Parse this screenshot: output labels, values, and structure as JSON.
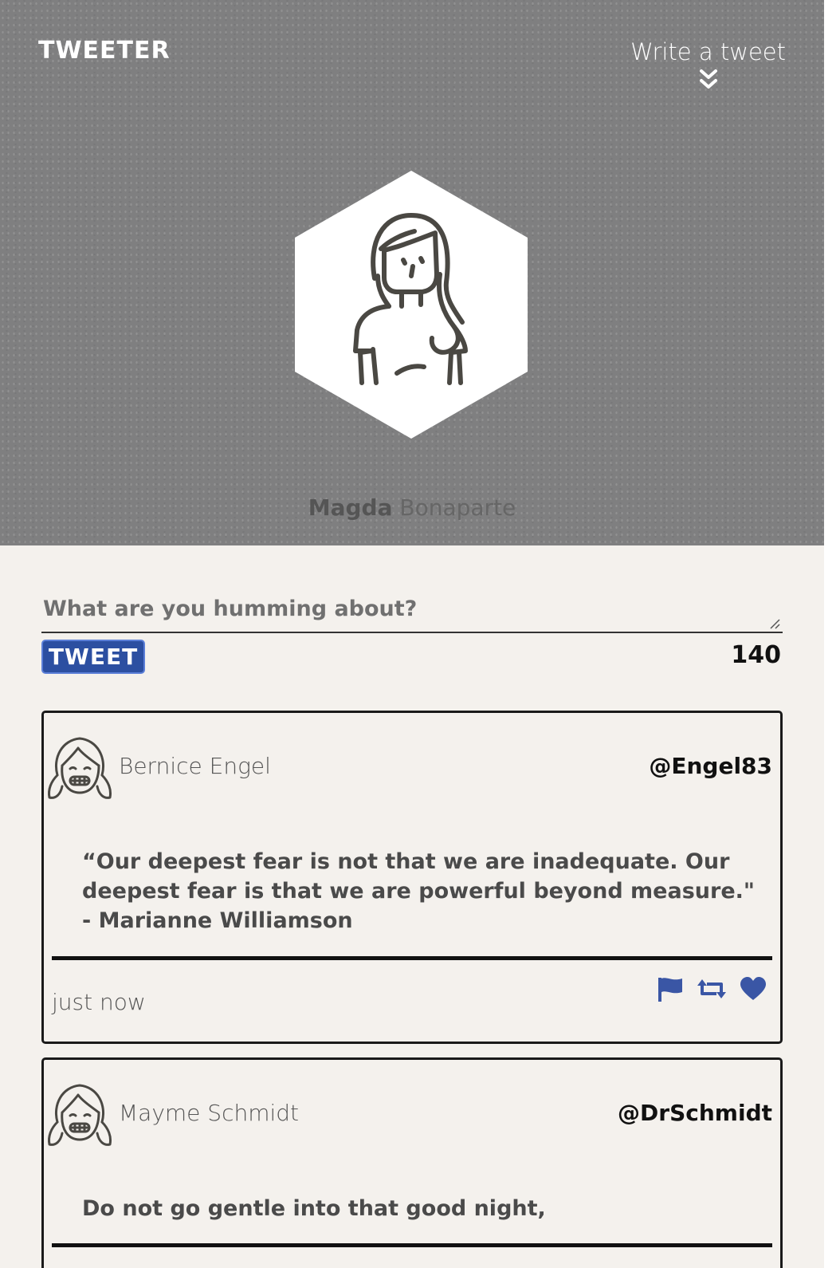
{
  "brand": {
    "logo_text": "TWEETER"
  },
  "nav": {
    "compose_toggle_label": "Write a tweet",
    "compose_toggle_icon": "double-chevron-down-icon"
  },
  "profile": {
    "avatar_icon": "woman-avatar-icon",
    "first_name": "Magda",
    "last_name": "Bonaparte"
  },
  "compose": {
    "placeholder": "What are you humming about?",
    "value": "",
    "submit_label": "TWEET",
    "char_remaining": "140"
  },
  "tweets": [
    {
      "author": "Bernice Engel",
      "handle": "@Engel83",
      "avatar_icon": "girl-avatar-icon",
      "text": "“Our deepest fear is not that we are inadequate. Our deepest fear is that we are powerful beyond measure.\" - Marianne Williamson",
      "time": "just now",
      "actions": [
        "flag-icon",
        "retweet-icon",
        "heart-icon"
      ]
    },
    {
      "author": "Mayme Schmidt",
      "handle": "@DrSchmidt",
      "avatar_icon": "girl-avatar-icon",
      "text": "Do not go gentle into that good night,"
    }
  ],
  "colors": {
    "header_bg": "#7f7f80",
    "page_bg": "#f4f1ed",
    "accent_blue": "#2c4fa1",
    "action_icon_blue": "#3a56a5"
  }
}
